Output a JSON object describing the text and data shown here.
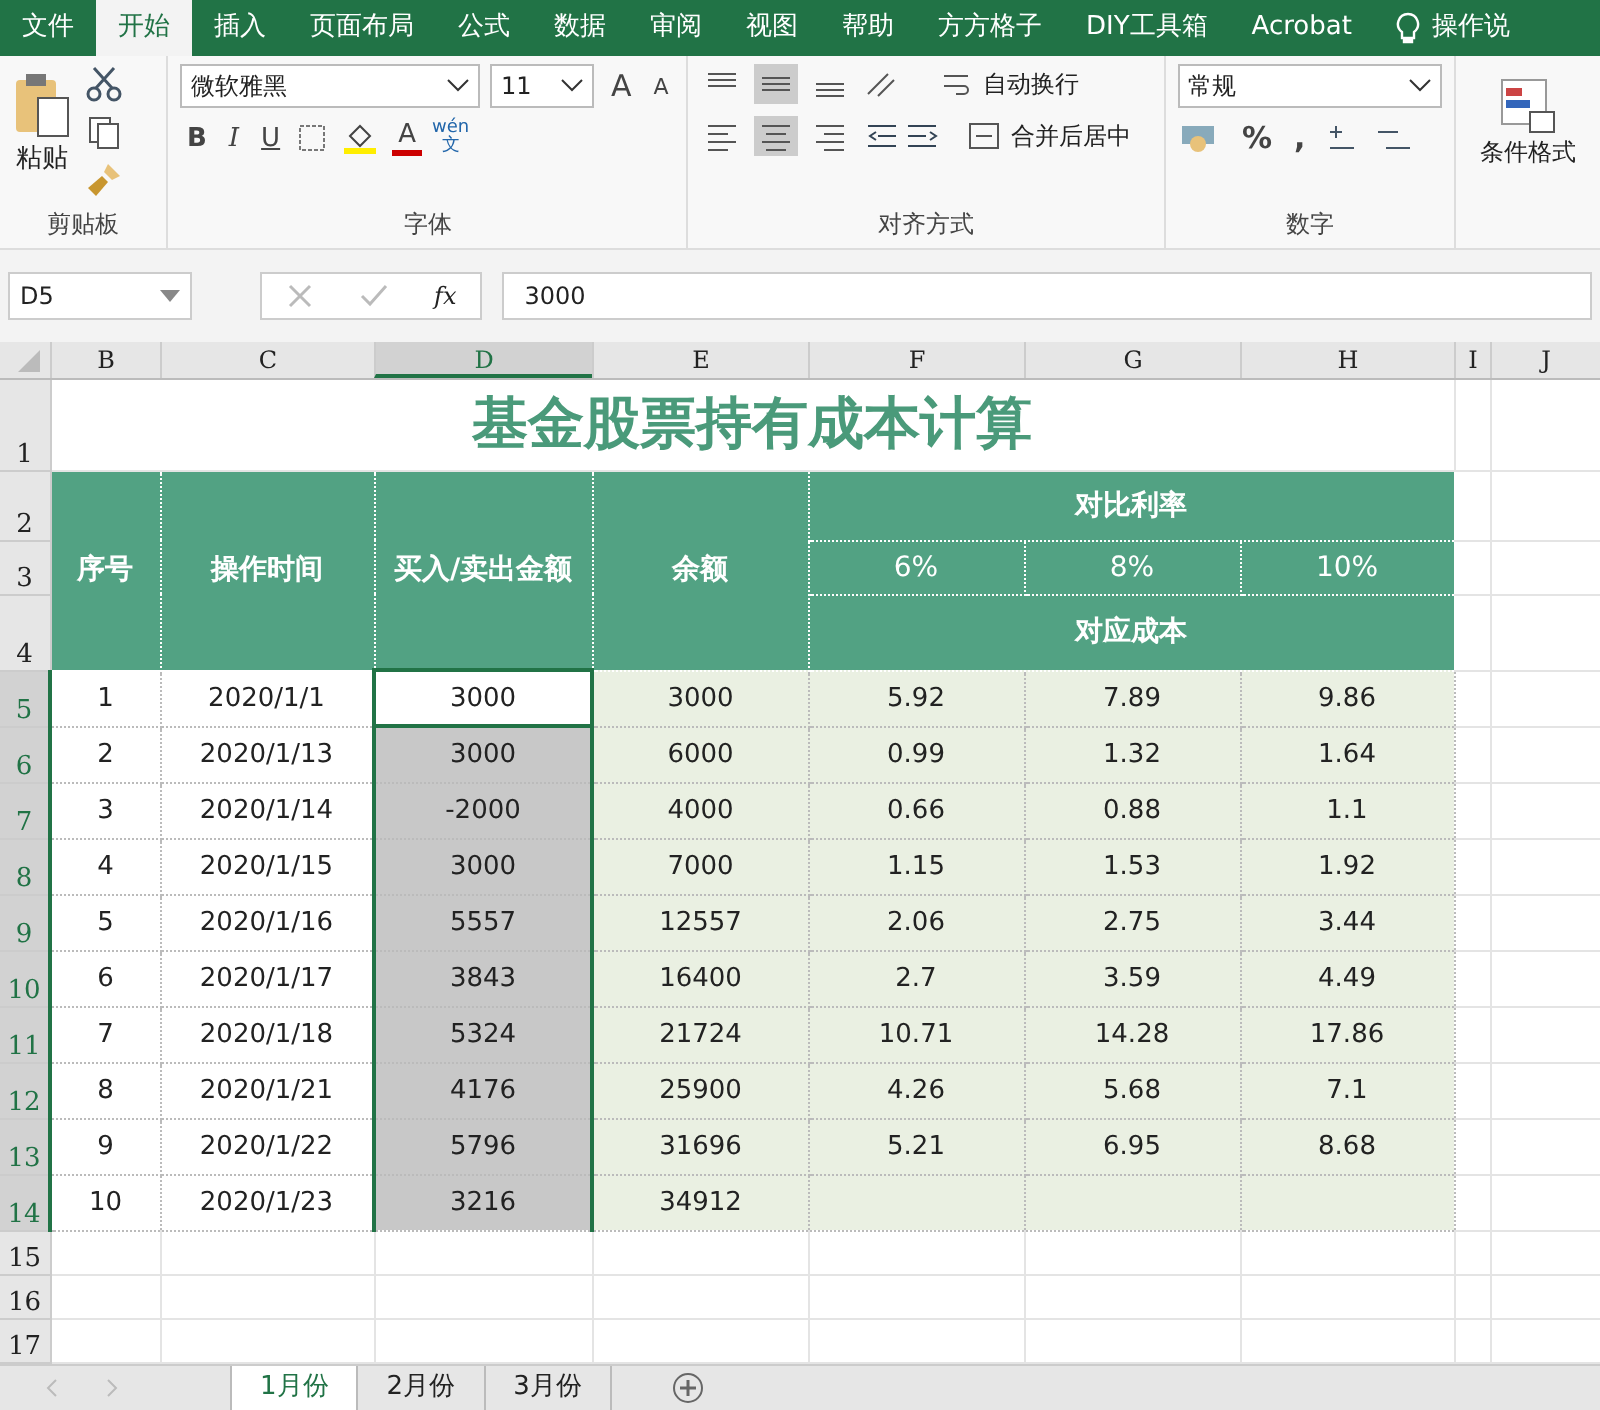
{
  "ribbon_tabs": [
    {
      "label": "文件",
      "selected": false
    },
    {
      "label": "开始",
      "selected": true
    },
    {
      "label": "插入",
      "selected": false
    },
    {
      "label": "页面布局",
      "selected": false
    },
    {
      "label": "公式",
      "selected": false
    },
    {
      "label": "数据",
      "selected": false
    },
    {
      "label": "审阅",
      "selected": false
    },
    {
      "label": "视图",
      "selected": false
    },
    {
      "label": "帮助",
      "selected": false
    },
    {
      "label": "方方格子",
      "selected": false
    },
    {
      "label": "DIY工具箱",
      "selected": false
    },
    {
      "label": "Acrobat",
      "selected": false
    },
    {
      "label": "操作说",
      "selected": false
    }
  ],
  "ribbon": {
    "clipboard": {
      "paste": "粘贴",
      "label": "剪贴板"
    },
    "font": {
      "name": "微软雅黑",
      "size": "11",
      "grow": "A",
      "shrink": "A",
      "bold": "B",
      "italic": "I",
      "underline": "U",
      "color_letter": "A",
      "phonetic_top": "wén",
      "phonetic_bottom": "文",
      "label": "字体"
    },
    "alignment": {
      "wrap": "自动换行",
      "merge": "合并后居中",
      "label": "对齐方式"
    },
    "number": {
      "format": "常规",
      "percent": "%",
      "comma": ",",
      "label": "数字"
    },
    "styles": {
      "conditional": "条件格式"
    }
  },
  "formula_bar": {
    "name_box": "D5",
    "fx": "fx",
    "value": "3000"
  },
  "columns": [
    {
      "label": "B",
      "selected": false
    },
    {
      "label": "C",
      "selected": false
    },
    {
      "label": "D",
      "selected": true
    },
    {
      "label": "E",
      "selected": false
    },
    {
      "label": "F",
      "selected": false
    },
    {
      "label": "G",
      "selected": false
    },
    {
      "label": "H",
      "selected": false
    },
    {
      "label": "I",
      "selected": false
    },
    {
      "label": "J",
      "selected": false
    }
  ],
  "sheet_title": "基金股票持有成本计算",
  "headers": {
    "seq": "序号",
    "date": "操作时间",
    "amount": "买入/卖出金额",
    "balance": "余额",
    "compare": "对比利率",
    "rates": [
      "6%",
      "8%",
      "10%"
    ],
    "cost": "对应成本"
  },
  "rows": [
    {
      "num": "5",
      "seq": "1",
      "date": "2020/1/1",
      "amount": "3000",
      "balance": "3000",
      "costs": [
        "5.92",
        "7.89",
        "9.86"
      ],
      "selected": true,
      "active": true
    },
    {
      "num": "6",
      "seq": "2",
      "date": "2020/1/13",
      "amount": "3000",
      "balance": "6000",
      "costs": [
        "0.99",
        "1.32",
        "1.64"
      ],
      "selected": true,
      "active": false
    },
    {
      "num": "7",
      "seq": "3",
      "date": "2020/1/14",
      "amount": "-2000",
      "balance": "4000",
      "costs": [
        "0.66",
        "0.88",
        "1.1"
      ],
      "selected": true,
      "active": false
    },
    {
      "num": "8",
      "seq": "4",
      "date": "2020/1/15",
      "amount": "3000",
      "balance": "7000",
      "costs": [
        "1.15",
        "1.53",
        "1.92"
      ],
      "selected": true,
      "active": false
    },
    {
      "num": "9",
      "seq": "5",
      "date": "2020/1/16",
      "amount": "5557",
      "balance": "12557",
      "costs": [
        "2.06",
        "2.75",
        "3.44"
      ],
      "selected": true,
      "active": false
    },
    {
      "num": "10",
      "seq": "6",
      "date": "2020/1/17",
      "amount": "3843",
      "balance": "16400",
      "costs": [
        "2.7",
        "3.59",
        "4.49"
      ],
      "selected": true,
      "active": false
    },
    {
      "num": "11",
      "seq": "7",
      "date": "2020/1/18",
      "amount": "5324",
      "balance": "21724",
      "costs": [
        "10.71",
        "14.28",
        "17.86"
      ],
      "selected": true,
      "active": false
    },
    {
      "num": "12",
      "seq": "8",
      "date": "2020/1/21",
      "amount": "4176",
      "balance": "25900",
      "costs": [
        "4.26",
        "5.68",
        "7.1"
      ],
      "selected": true,
      "active": false
    },
    {
      "num": "13",
      "seq": "9",
      "date": "2020/1/22",
      "amount": "5796",
      "balance": "31696",
      "costs": [
        "5.21",
        "6.95",
        "8.68"
      ],
      "selected": true,
      "active": false
    },
    {
      "num": "14",
      "seq": "10",
      "date": "2020/1/23",
      "amount": "3216",
      "balance": "34912",
      "costs": [],
      "selected": true,
      "active": false
    }
  ],
  "header_row_numbers": [
    "1",
    "2",
    "3",
    "4"
  ],
  "empty_row_numbers": [
    "15",
    "16",
    "17"
  ],
  "sheet_tabs": [
    {
      "label": "1月份",
      "selected": true
    },
    {
      "label": "2月份",
      "selected": false
    },
    {
      "label": "3月份",
      "selected": false
    }
  ]
}
